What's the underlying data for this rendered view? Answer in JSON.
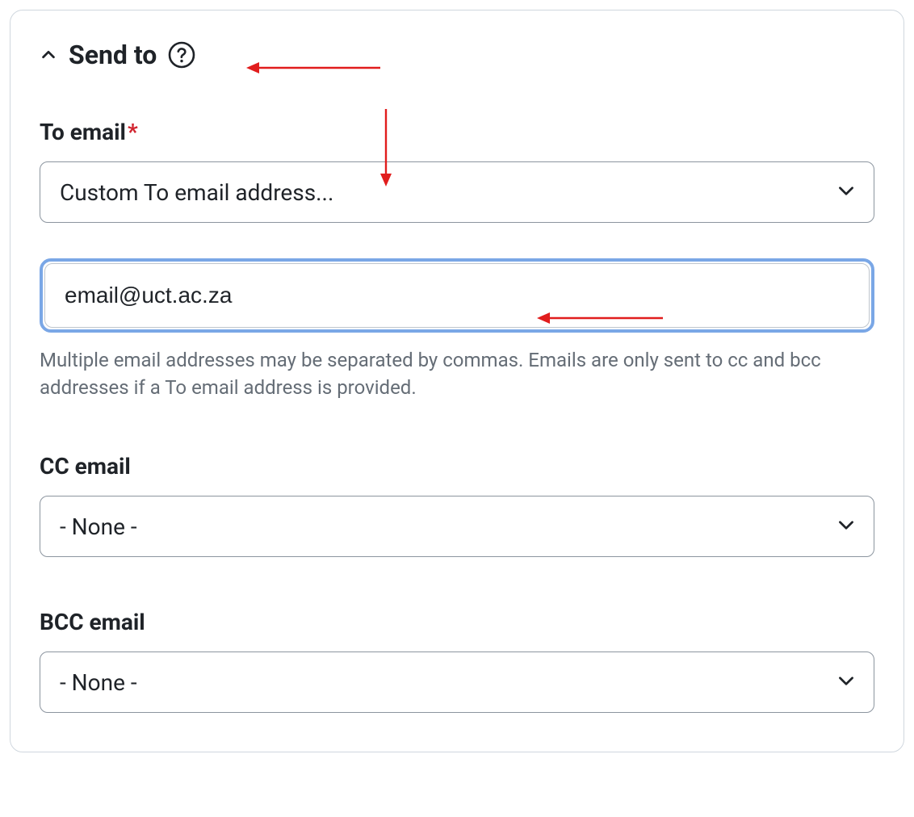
{
  "section": {
    "title": "Send to"
  },
  "fields": {
    "to": {
      "label": "To email",
      "required_marker": "*",
      "select_value": "Custom To email address...",
      "input_value": "email@uct.ac.za",
      "help_text": "Multiple email addresses may be separated by commas. Emails are only sent to cc and bcc addresses if a To email address is provided."
    },
    "cc": {
      "label": "CC email",
      "select_value": "- None -"
    },
    "bcc": {
      "label": "BCC email",
      "select_value": "- None -"
    }
  },
  "colors": {
    "border": "#d0d7de",
    "text": "#1f2328",
    "muted": "#656d76",
    "required": "#d1242f",
    "focus": "#7aa7e6",
    "annotation": "#e11d1d"
  }
}
